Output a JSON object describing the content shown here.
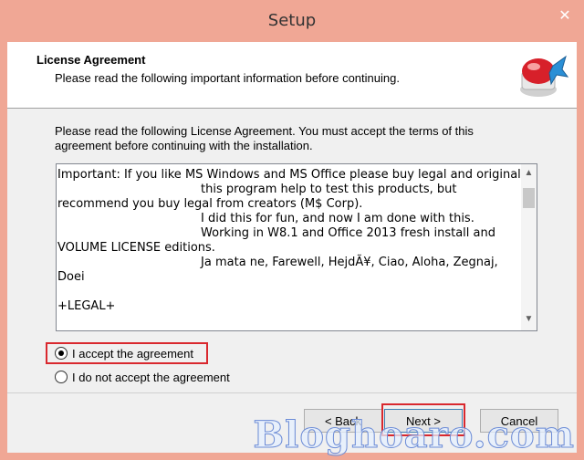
{
  "window": {
    "title": "Setup",
    "close_glyph": "✕"
  },
  "header": {
    "title": "License Agreement",
    "subtitle": "Please read the following important information before continuing.",
    "logo_icon": "setup-installer-icon"
  },
  "intro": "Please read the following License Agreement. You must accept the terms of this agreement before continuing with the installation.",
  "license_text": "Important: If you like MS Windows and MS Office please buy legal and original\n                                      this program help to test this products, but\nrecommend you buy legal from creators (M$ Corp).\n                                      I did this for fun, and now I am done with this.\n                                      Working in W8.1 and Office 2013 fresh install and\nVOLUME LICENSE editions.\n                                      Ja mata ne, Farewell, HejdÃ¥, Ciao, Aloha, Zegnaj,\nDoei\n\n+LEGAL+",
  "options": {
    "accept_label": "I accept the agreement",
    "decline_label": "I do not accept the agreement",
    "selected": "accept"
  },
  "buttons": {
    "back": "< Back",
    "next": "Next >",
    "cancel": "Cancel"
  },
  "watermark": "Bloghoaro.com",
  "colors": {
    "titlebar": "#f0a795",
    "highlight": "#d9282e",
    "watermark_outline": "#6b8bd6"
  }
}
